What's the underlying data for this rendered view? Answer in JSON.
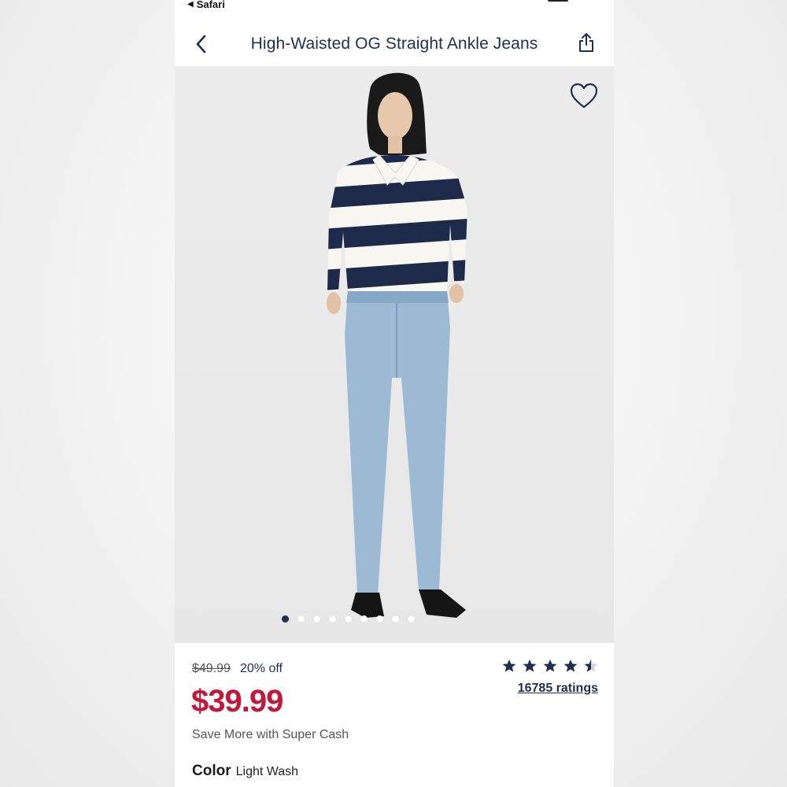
{
  "status_bar": {
    "back_app": "Safari"
  },
  "nav": {
    "title": "High-Waisted OG Straight Ankle Jeans",
    "back_icon": "chevron-left-icon",
    "share_icon": "share-icon"
  },
  "product_image": {
    "favorite_icon": "heart-icon",
    "carousel_total": 9,
    "carousel_active_index": 0
  },
  "pricing": {
    "original_price": "$49.99",
    "discount": "20% off",
    "sale_price": "$39.99",
    "super_cash": "Save More with Super Cash"
  },
  "rating": {
    "stars": 4.5,
    "max_stars": 5,
    "count_label": "16785 ratings"
  },
  "color": {
    "label": "Color",
    "value": "Light Wash"
  },
  "colors": {
    "navy": "#1f2f52",
    "sale_red": "#c2183a"
  }
}
